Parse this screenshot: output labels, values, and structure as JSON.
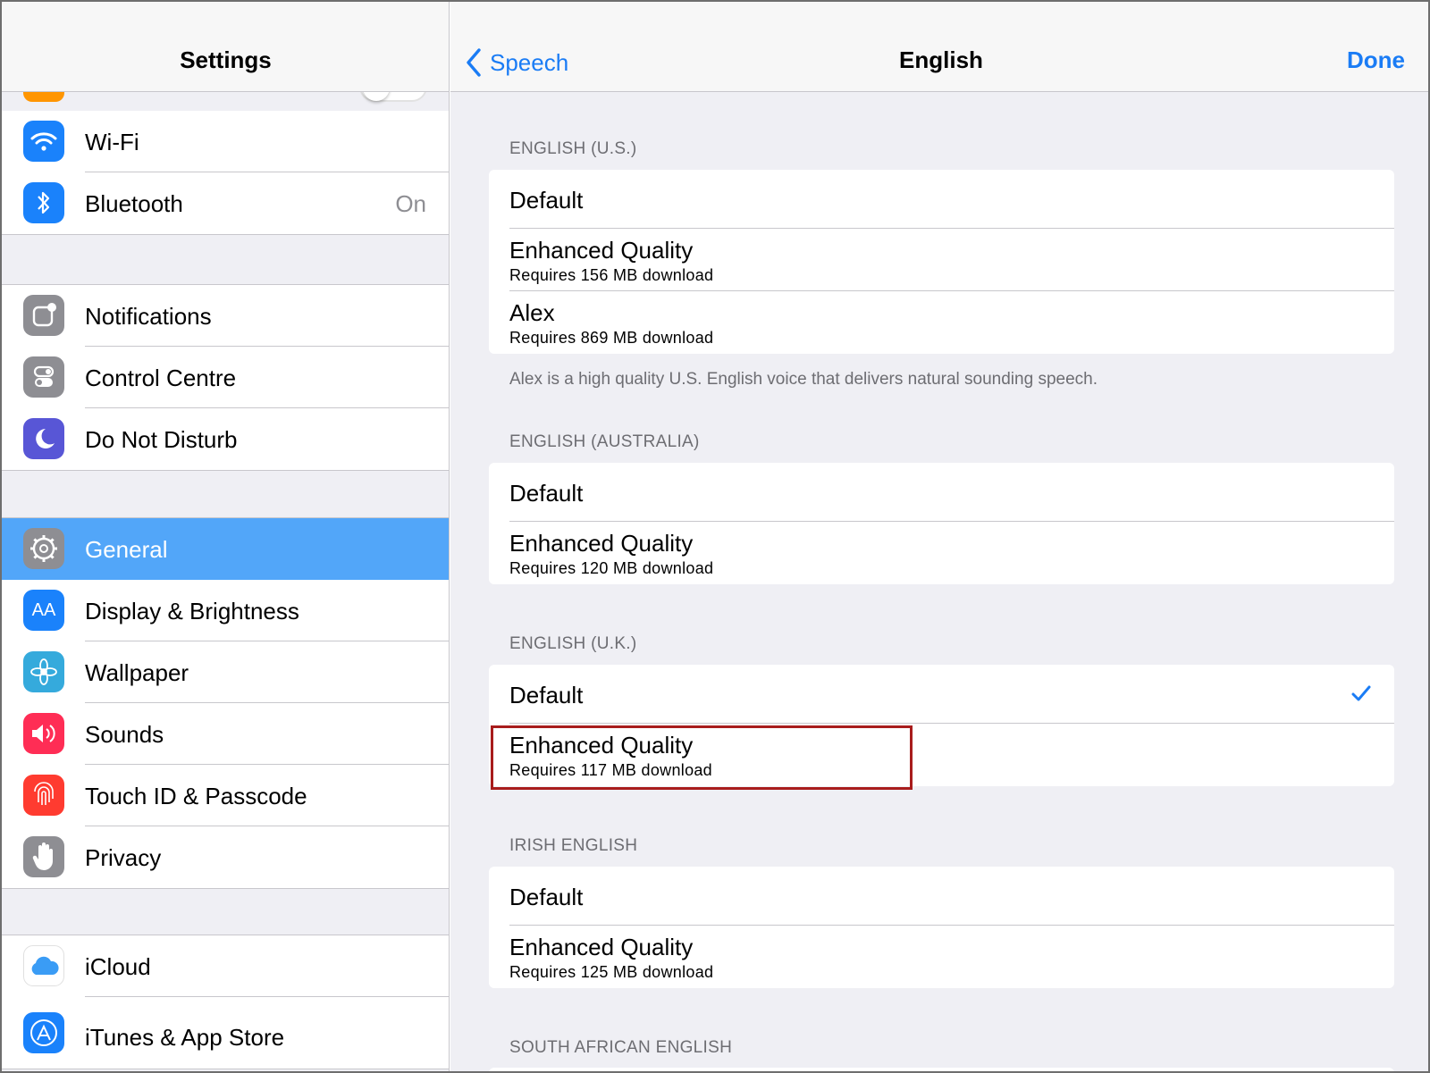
{
  "left": {
    "title": "Settings",
    "group1": [
      {
        "label": "Wi-Fi",
        "icon": "wifi-icon",
        "color": "#1a82fb"
      },
      {
        "label": "Bluetooth",
        "value": "On",
        "icon": "bluetooth-icon",
        "color": "#1a82fb"
      }
    ],
    "group2": [
      {
        "label": "Notifications",
        "icon": "notifications-icon",
        "color": "#8e8e93"
      },
      {
        "label": "Control Centre",
        "icon": "control-centre-icon",
        "color": "#8e8e93"
      },
      {
        "label": "Do Not Disturb",
        "icon": "moon-icon",
        "color": "#5856d6"
      }
    ],
    "group3": [
      {
        "label": "General",
        "icon": "gear-icon",
        "color": "#8e8e93",
        "selected": true
      },
      {
        "label": "Display & Brightness",
        "icon": "text-size-icon",
        "color": "#1a82fb",
        "glyph": "AA"
      },
      {
        "label": "Wallpaper",
        "icon": "flower-icon",
        "color": "#35aadc"
      },
      {
        "label": "Sounds",
        "icon": "speaker-icon",
        "color": "#ff2d55"
      },
      {
        "label": "Touch ID & Passcode",
        "icon": "fingerprint-icon",
        "color": "#ff3b30"
      },
      {
        "label": "Privacy",
        "icon": "hand-icon",
        "color": "#8e8e93"
      }
    ],
    "group4": [
      {
        "label": "iCloud",
        "icon": "icloud-icon",
        "color": "#ffffff"
      },
      {
        "label": "iTunes & App Store",
        "icon": "app-store-icon",
        "color": "#1a82fb"
      }
    ]
  },
  "right": {
    "back_label": "Speech",
    "title": "English",
    "done_label": "Done",
    "accent_color": "#1a7cf5",
    "sections": [
      {
        "title": "ENGLISH (U.S.)",
        "rows": [
          {
            "main": "Default"
          },
          {
            "main": "Enhanced Quality",
            "sub": "Requires 156 MB download"
          },
          {
            "main": "Alex",
            "sub": "Requires 869 MB download"
          }
        ],
        "footnote": "Alex is a high quality U.S. English voice that delivers natural sounding speech."
      },
      {
        "title": "ENGLISH (AUSTRALIA)",
        "rows": [
          {
            "main": "Default"
          },
          {
            "main": "Enhanced Quality",
            "sub": "Requires 120 MB download"
          }
        ]
      },
      {
        "title": "ENGLISH (U.K.)",
        "rows": [
          {
            "main": "Default",
            "checked": true
          },
          {
            "main": "Enhanced Quality",
            "sub": "Requires 117 MB download",
            "highlighted": true
          }
        ]
      },
      {
        "title": "IRISH ENGLISH",
        "rows": [
          {
            "main": "Default"
          },
          {
            "main": "Enhanced Quality",
            "sub": "Requires 125 MB download"
          }
        ]
      },
      {
        "title": "SOUTH AFRICAN ENGLISH",
        "rows": []
      }
    ]
  }
}
